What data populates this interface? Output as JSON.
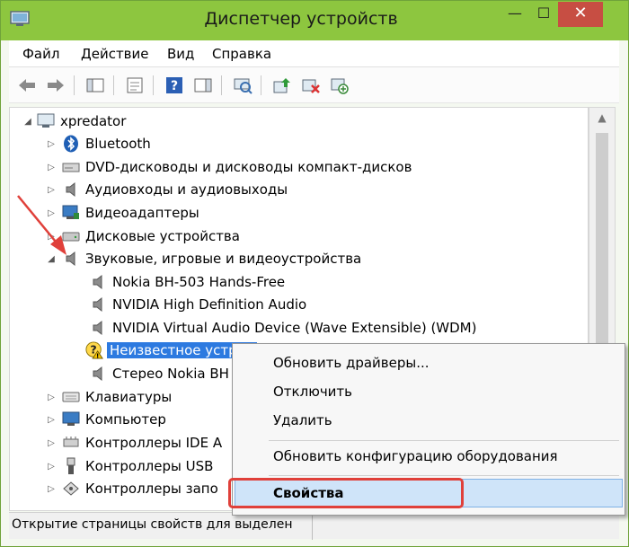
{
  "window": {
    "title": "Диспетчер устройств",
    "controls": {
      "minimize": "—",
      "maximize": "☐",
      "close": "✕"
    }
  },
  "menu": [
    "Файл",
    "Действие",
    "Вид",
    "Справка"
  ],
  "toolbar": {
    "icons": [
      "back-icon",
      "forward-icon",
      "show-hide-console-tree-icon",
      "properties-icon",
      "help-icon",
      "action-pane-icon",
      "scan-hardware-icon",
      "update-driver-icon",
      "uninstall-device-icon",
      "add-legacy-hardware-icon"
    ]
  },
  "tree": {
    "root": "xpredator",
    "categories": [
      "Bluetooth",
      "DVD-дисководы и дисководы компакт-дисков",
      "Аудиовходы и аудиовыходы",
      "Видеоадаптеры",
      "Дисковые устройства",
      "Звуковые, игровые и видеоустройства"
    ],
    "sound_children": [
      "Nokia BH-503 Hands-Free",
      "NVIDIA High Definition Audio",
      "NVIDIA Virtual Audio Device (Wave Extensible) (WDM)",
      "Неизвестное устрой",
      "Стерео Nokia BH"
    ],
    "categories_after": [
      "Клавиатуры",
      "Компьютер",
      "Контроллеры IDE A",
      "Контроллеры USB",
      "Контроллеры запо"
    ]
  },
  "context_menu": {
    "items": [
      "Обновить драйверы...",
      "Отключить",
      "Удалить",
      "Обновить конфигурацию оборудования",
      "Свойства"
    ],
    "highlighted": "Свойства"
  },
  "status": {
    "text": "Открытие страницы свойств для выделен"
  },
  "colors": {
    "titlebar": "#8dc63f",
    "selection": "#2d7ae0",
    "annotation": "#e0403a",
    "menu_highlight": "#cfe4f9"
  }
}
